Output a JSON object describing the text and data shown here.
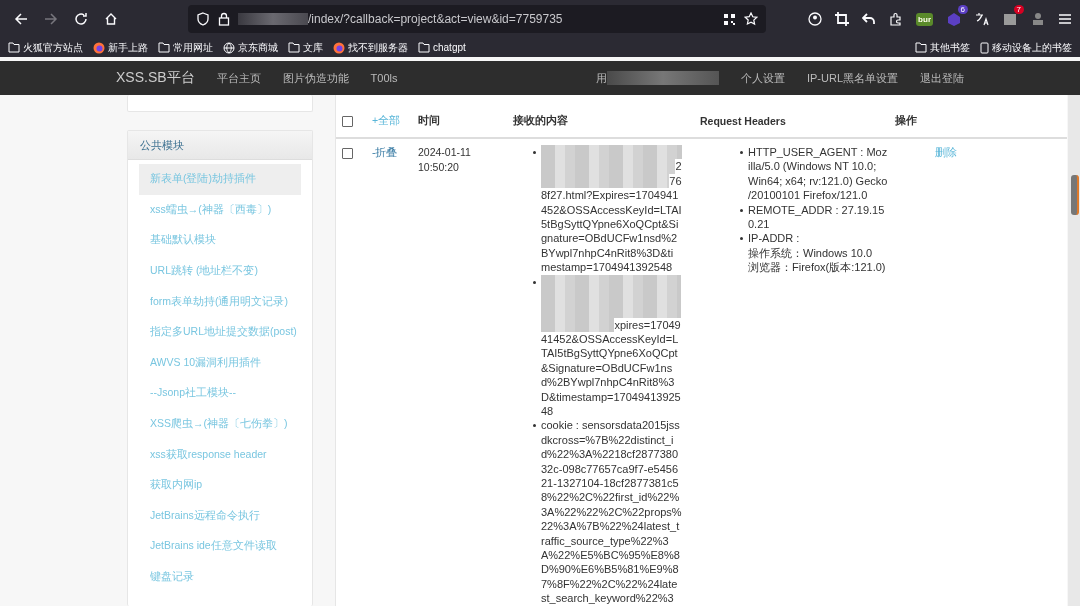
{
  "browser": {
    "url": "/index/?callback=project&act=view&id=7759735",
    "bookmarks": [
      {
        "label": "火狐官方站点",
        "kind": "folder"
      },
      {
        "label": "新手上路",
        "kind": "site"
      },
      {
        "label": "常用网址",
        "kind": "folder"
      },
      {
        "label": "京东商城",
        "kind": "web"
      },
      {
        "label": "文库",
        "kind": "folder"
      },
      {
        "label": "找不到服务器",
        "kind": "site"
      },
      {
        "label": "chatgpt",
        "kind": "folder"
      }
    ],
    "other_bookmarks": "其他书签",
    "mobile_bookmarks": "移动设备上的书签",
    "badges": [
      "6",
      "7"
    ],
    "ext_label": "bur"
  },
  "site_nav": {
    "brand": "XSS.SB平台",
    "links": [
      "平台主页",
      "图片伪造功能",
      "T00ls"
    ],
    "user_prefix": "用",
    "right_links": [
      "个人设置",
      "IP-URL黑名单设置",
      "退出登陆"
    ]
  },
  "sidebar": {
    "title": "公共模块",
    "items": [
      {
        "label": "新表单(登陆)劫持插件",
        "selected": true
      },
      {
        "label": "xss蠕虫→(神器〔西毒〕)",
        "selected": false
      },
      {
        "label": "基础默认模块",
        "selected": false
      },
      {
        "label": "URL跳转 (地址栏不变)",
        "selected": false
      },
      {
        "label": "form表单劫持(通用明文记录)",
        "selected": false
      },
      {
        "label": "指定多URL地址提交数据(post)",
        "selected": false
      },
      {
        "label": "AWVS 10漏洞利用插件",
        "selected": false
      },
      {
        "label": "--Jsonp社工模块--",
        "selected": false
      },
      {
        "label": "XSS爬虫→(神器〔七伤拳〕)",
        "selected": false
      },
      {
        "label": "xss获取response header",
        "selected": false
      },
      {
        "label": "获取内网ip",
        "selected": false
      },
      {
        "label": "JetBrains远程命令执行",
        "selected": false
      },
      {
        "label": "JetBrains ide任意文件读取",
        "selected": false
      },
      {
        "label": "键盘记录",
        "selected": false
      }
    ]
  },
  "table": {
    "select_all_checked": false,
    "columns": [
      "+全部",
      "时间",
      "接收的内容",
      "Request Headers",
      "操作"
    ],
    "rows": [
      {
        "checked": false,
        "toggle": "-折叠",
        "time": [
          "2024-01-11",
          "10:50:20"
        ],
        "content": [
          {
            "lines": [
              {
                "redacted": true
              },
              {
                "redacted": true,
                "text": "2"
              },
              {
                "redacted": true,
                "text": "76"
              },
              {
                "redacted": false,
                "text": "8f27.html?Expires=1704941"
              },
              {
                "redacted": false,
                "text": "452&OSSAccessKeyId=LTAI"
              },
              {
                "redacted": false,
                "text": "5tBgSyttQYpne6XoQCpt&Si"
              },
              {
                "redacted": false,
                "text": "gnature=OBdUCFw1nsd%2"
              },
              {
                "redacted": false,
                "text": "BYwpl7nhpC4nRit8%3D&ti"
              },
              {
                "redacted": false,
                "text": "mestamp=1704941392548"
              }
            ]
          },
          {
            "lines": [
              {
                "redacted": true
              },
              {
                "redacted": true
              },
              {
                "redacted": true
              },
              {
                "redacted": true,
                "text": "xpires=17049"
              },
              {
                "redacted": false,
                "text": "41452&OSSAccessKeyId=L"
              },
              {
                "redacted": false,
                "text": "TAI5tBgSyttQYpne6XoQCpt"
              },
              {
                "redacted": false,
                "text": "&Signature=OBdUCFw1ns"
              },
              {
                "redacted": false,
                "text": "d%2BYwpl7nhpC4nRit8%3"
              },
              {
                "redacted": false,
                "text": "D&timestamp=17049413925"
              },
              {
                "redacted": false,
                "text": "48"
              }
            ]
          },
          {
            "lines": [
              {
                "redacted": false,
                "text": "cookie : sensorsdata2015jss"
              },
              {
                "redacted": false,
                "text": "dkcross=%7B%22distinct_i"
              },
              {
                "redacted": false,
                "text": "d%22%3A%2218cf2877380"
              },
              {
                "redacted": false,
                "text": "32c-098c77657ca9f7-e5456"
              },
              {
                "redacted": false,
                "text": "21-1327104-18cf2877381c5"
              },
              {
                "redacted": false,
                "text": "8%22%2C%22first_id%22%"
              },
              {
                "redacted": false,
                "text": "3A%22%22%2C%22props%"
              },
              {
                "redacted": false,
                "text": "22%3A%7B%22%24latest_t"
              },
              {
                "redacted": false,
                "text": "raffic_source_type%22%3"
              },
              {
                "redacted": false,
                "text": "A%22%E5%BC%95%E8%8"
              },
              {
                "redacted": false,
                "text": "D%90%E6%B5%81%E9%8"
              },
              {
                "redacted": false,
                "text": "7%8F%22%2C%22%24late"
              },
              {
                "redacted": false,
                "text": "st_search_keyword%22%3"
              }
            ]
          }
        ],
        "headers": [
          [
            "HTTP_USER_AGENT : Moz",
            "illa/5.0 (Windows NT 10.0;",
            "Win64; x64; rv:121.0) Gecko",
            "/20100101 Firefox/121.0"
          ],
          [
            "REMOTE_ADDR : 27.19.15",
            "0.21"
          ],
          [
            "IP-ADDR :",
            "操作系统：Windows 10.0",
            "浏览器：Firefox(版本:121.0)"
          ]
        ],
        "action": "删除"
      }
    ]
  }
}
